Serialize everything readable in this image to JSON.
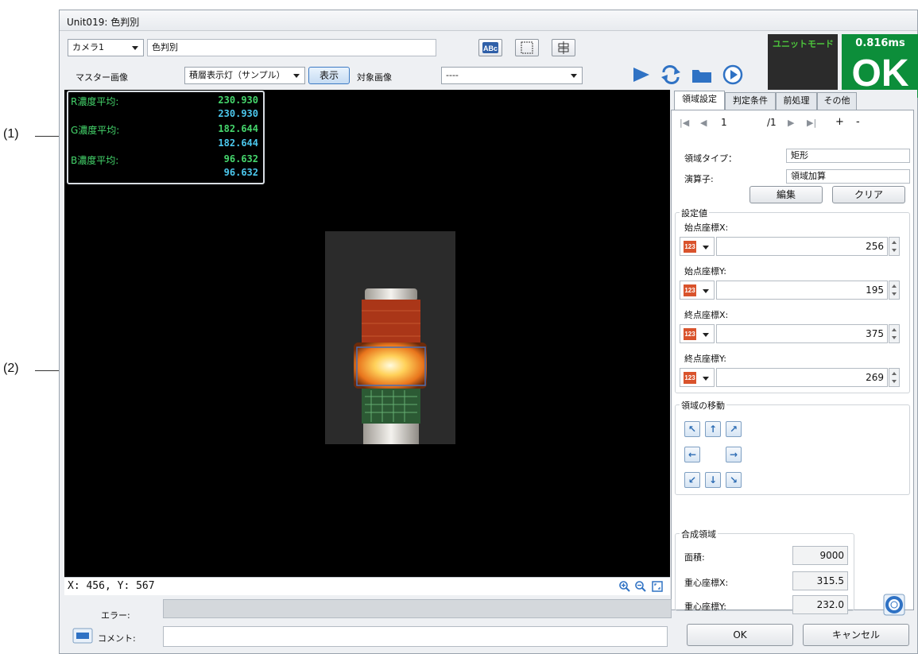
{
  "callouts": {
    "c1": "(1)",
    "c2": "(2)"
  },
  "window": {
    "title": "Unit019: 色判別"
  },
  "toolbar": {
    "camera_select": "カメラ1",
    "unit_name": "色判別",
    "master_label": "マスター画像",
    "master_select": "積層表示灯（サンプル）",
    "show_button": "表示",
    "target_label": "対象画像",
    "target_select": "----"
  },
  "status": {
    "mode": "ユニットモード",
    "time": "0.816ms",
    "result": "OK"
  },
  "overlay": {
    "r_label": "R濃度平均:",
    "r_value": "230.930",
    "r_value2": "230.930",
    "g_label": "G濃度平均:",
    "g_value": "182.644",
    "g_value2": "182.644",
    "b_label": "B濃度平均:",
    "b_value": "96.632",
    "b_value2": "96.632"
  },
  "coords": "X: 456, Y: 567",
  "tabs": [
    "領域設定",
    "判定条件",
    "前処理",
    "その他"
  ],
  "nav": {
    "index": "1",
    "total": "/1",
    "plus": "+",
    "minus": "-"
  },
  "region": {
    "type_label": "領域タイプ：",
    "type_value": "矩形",
    "op_label": "演算子:",
    "op_value": "領域加算",
    "edit_button": "編集",
    "clear_button": "クリア"
  },
  "settings": {
    "title": "設定値",
    "fields": [
      {
        "label": "始点座標X:",
        "value": "256"
      },
      {
        "label": "始点座標Y:",
        "value": "195"
      },
      {
        "label": "終点座標X:",
        "value": "375"
      },
      {
        "label": "終点座標Y:",
        "value": "269"
      }
    ]
  },
  "move": {
    "title": "領域の移動"
  },
  "composite": {
    "title": "合成領域",
    "area_label": "面積:",
    "area_value": "9000",
    "cx_label": "重心座標X:",
    "cx_value": "315.5",
    "cy_label": "重心座標Y:",
    "cy_value": "232.0"
  },
  "bottom": {
    "error_label": "エラー:",
    "comment_label": "コメント:",
    "ok_button": "OK",
    "cancel_button": "キャンセル"
  },
  "colors": {
    "result_green": "#0c8e3a",
    "mode_text": "#4cc43c",
    "overlay_green": "#45d66c",
    "overlay_cyan": "#4cc8ee"
  },
  "icons": [
    "abc-icon",
    "region-icon",
    "align-icon",
    "play-icon",
    "repeat-icon",
    "folder-icon",
    "run-icon",
    "zoom-in-icon",
    "zoom-out-icon",
    "fit-icon",
    "keyboard-icon",
    "help-icon"
  ]
}
